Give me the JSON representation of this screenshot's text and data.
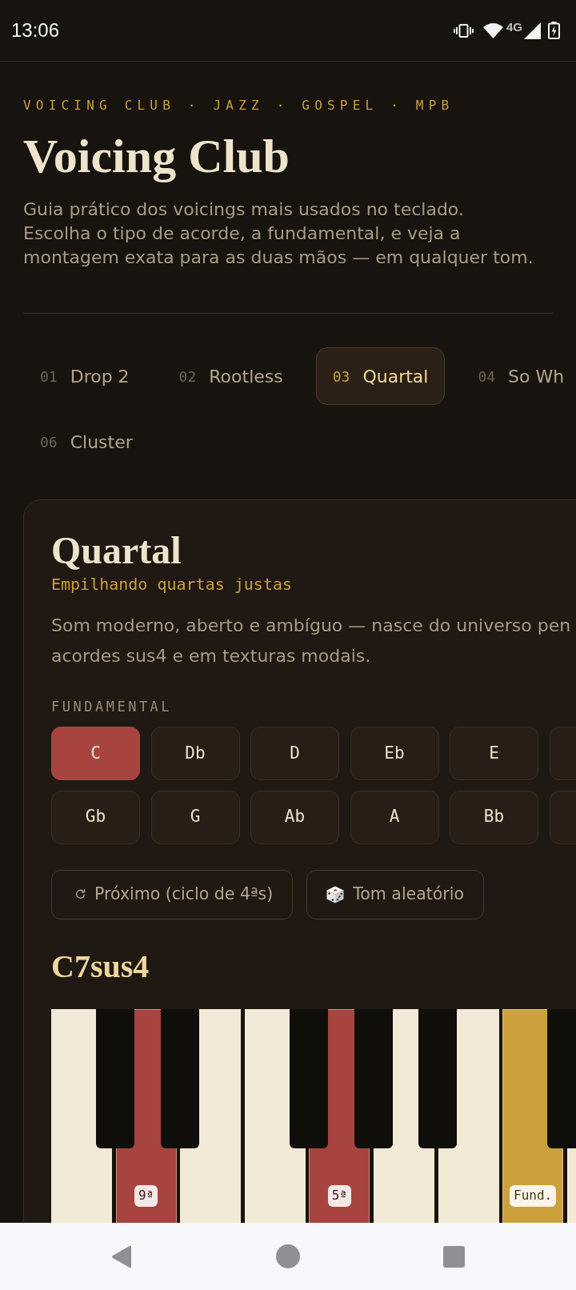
{
  "status_bar": {
    "time": "13:06",
    "network": "4G"
  },
  "header": {
    "eyebrow": "VOICING CLUB · JAZZ · GOSPEL · MPB",
    "title": "Voicing Club",
    "description_lines": [
      "Guia prático dos voicings mais usados no teclado.",
      "Escolha o tipo de acorde, a fundamental, e veja a",
      "montagem exata para as duas mãos — em qualquer tom."
    ]
  },
  "tabs": [
    {
      "number": "01",
      "label": "Drop 2",
      "selected": false
    },
    {
      "number": "02",
      "label": "Rootless",
      "selected": false
    },
    {
      "number": "03",
      "label": "Quartal",
      "selected": true
    },
    {
      "number": "04",
      "label": "So Wh",
      "selected": false
    },
    {
      "number": "06",
      "label": "Cluster",
      "selected": false
    }
  ],
  "card": {
    "title": "Quartal",
    "subtitle": "Empilhando quartas justas",
    "description_lines": [
      "Som moderno, aberto e ambíguo — nasce do universo pen",
      "acordes sus4 e em texturas modais."
    ],
    "roots_label": "FUNDAMENTAL",
    "roots": [
      {
        "label": "C",
        "selected": true
      },
      {
        "label": "Db",
        "selected": false
      },
      {
        "label": "D",
        "selected": false
      },
      {
        "label": "Eb",
        "selected": false
      },
      {
        "label": "E",
        "selected": false
      },
      {
        "selected": false
      },
      {
        "label": "Gb",
        "selected": false
      },
      {
        "label": "G",
        "selected": false
      },
      {
        "label": "Ab",
        "selected": false
      },
      {
        "label": "A",
        "selected": false
      },
      {
        "label": "Bb",
        "selected": false
      },
      {
        "selected": false
      }
    ],
    "actions": [
      {
        "kind": "cycle",
        "label": "Próximo (ciclo de 4ªs)"
      },
      {
        "kind": "random",
        "label": "Tom aleatório"
      }
    ],
    "chord_name": "C7sus4",
    "keyboard": {
      "white_keys": [
        {
          "highlighted": false
        },
        {
          "highlighted": true,
          "color": "#a8443f",
          "badge": "9ª"
        },
        {
          "highlighted": false
        },
        {
          "highlighted": false
        },
        {
          "highlighted": true,
          "color": "#a8443f",
          "badge": "5ª"
        },
        {
          "highlighted": false
        },
        {
          "highlighted": false
        },
        {
          "highlighted": true,
          "color": "#cca13d",
          "badge": "Fund."
        },
        {
          "highlighted": false
        }
      ],
      "black_keys": [
        {
          "highlighted": false
        },
        {
          "highlighted": false
        },
        {
          "highlighted": false
        },
        {
          "highlighted": false
        },
        {
          "highlighted": false
        },
        {
          "highlighted": false
        }
      ]
    }
  }
}
